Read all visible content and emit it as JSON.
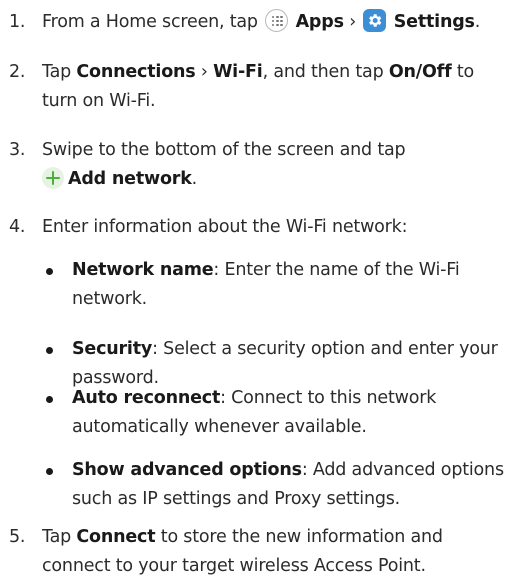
{
  "steps": [
    {
      "number": "1.",
      "text_a": "From a Home screen, tap",
      "apps_label": "Apps",
      "sep": "›",
      "settings_label": "Settings",
      "end": "."
    },
    {
      "number": "2.",
      "text_a": "Tap",
      "connections_label": "Connections",
      "sep": "›",
      "wifi_label": "Wi-Fi",
      "text_b": ", and then tap",
      "onoff_label": "On/Off",
      "text_c": "to",
      "text_d": "turn on Wi-Fi."
    },
    {
      "number": "3.",
      "line1": "Swipe to the bottom of the screen and tap",
      "add_network_label": "Add network",
      "end": "."
    },
    {
      "number": "4.",
      "text": "Enter information about the Wi-Fi network:"
    },
    {
      "number": "5.",
      "text_a": "Tap",
      "connect_label": "Connect",
      "text_b": "to store the new information and",
      "line2": "connect to your target wireless Access Point."
    }
  ],
  "bullets": [
    {
      "term": "Network name",
      "line1": ": Enter the name of the Wi-Fi",
      "line2": "network."
    },
    {
      "term": "Security",
      "line1": ": Select a security option and enter your",
      "line2": "password."
    },
    {
      "term": "Auto reconnect",
      "line1": ": Connect to this network",
      "line2": "automatically whenever available."
    },
    {
      "term": "Show advanced options",
      "line1": ": Add advanced options",
      "line2": "such as IP settings and Proxy settings."
    }
  ],
  "icons": {
    "apps": "apps-grid-icon",
    "settings": "settings-gear-icon",
    "add": "plus-icon"
  },
  "colors": {
    "settings_icon_bg": "#3c8fd6",
    "plus_icon": "#4caf3a",
    "text": "#2b2b2b"
  }
}
